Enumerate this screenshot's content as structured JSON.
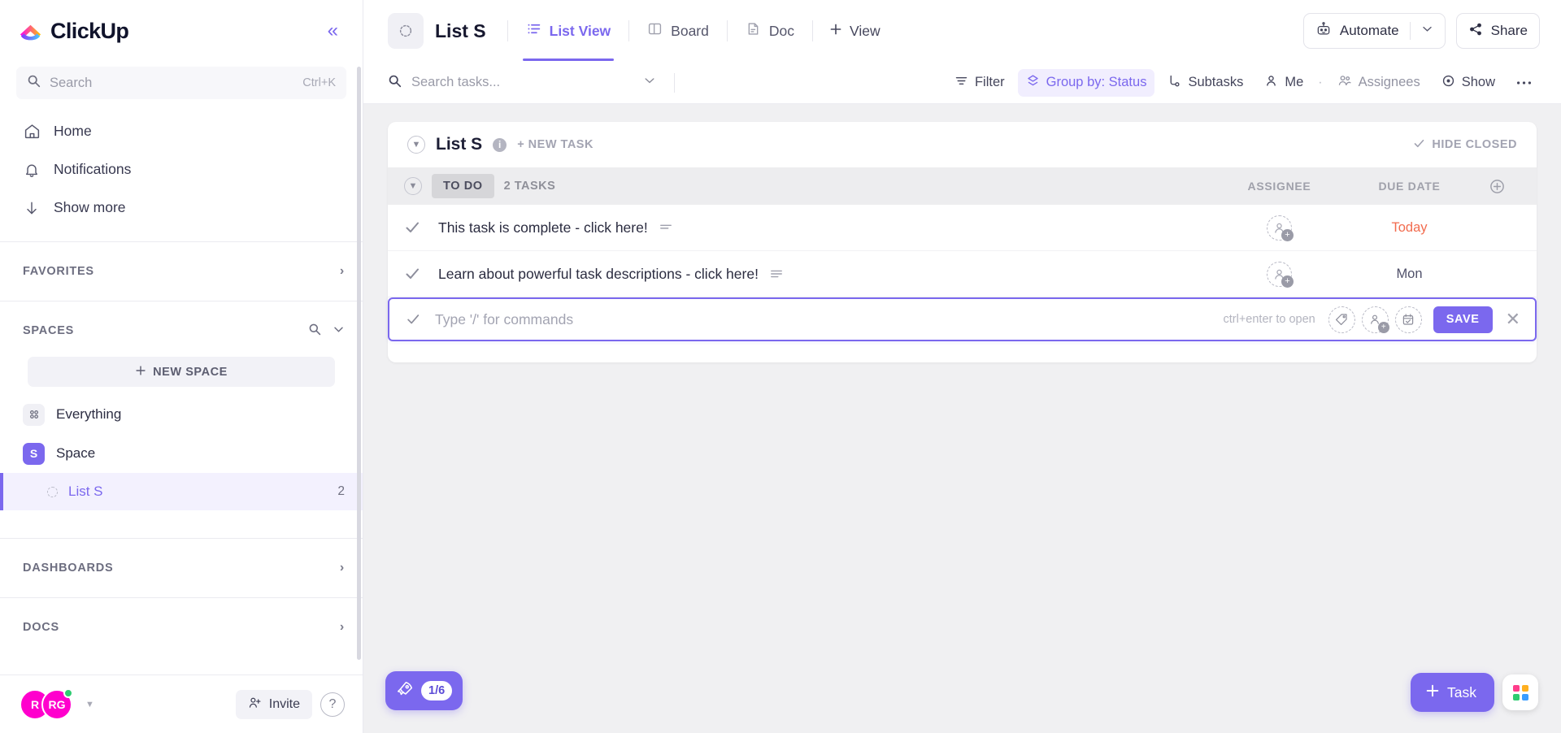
{
  "brand": {
    "name": "ClickUp",
    "accent": "#7b68ee",
    "logo_icon": "clickup-logo-icon"
  },
  "sidebar": {
    "search": {
      "placeholder": "Search",
      "shortcut": "Ctrl+K",
      "icon": "search-icon"
    },
    "nav": [
      {
        "label": "Home",
        "icon": "home-icon"
      },
      {
        "label": "Notifications",
        "icon": "bell-icon"
      },
      {
        "label": "Show more",
        "icon": "arrow-down-icon"
      }
    ],
    "favorites": {
      "label": "FAVORITES",
      "chevron": "chevron-right-icon"
    },
    "spaces": {
      "label": "SPACES",
      "search_icon": "search-icon",
      "chevron_icon": "chevron-down-icon",
      "new_space_label": "NEW SPACE",
      "everything": {
        "label": "Everything",
        "icon": "grid-dots-icon"
      },
      "space": {
        "label": "Space",
        "initial": "S",
        "color": "#7b68ee"
      },
      "list": {
        "label": "List S",
        "count": "2"
      }
    },
    "dashboards": {
      "label": "DASHBOARDS",
      "chevron": "chevron-right-icon"
    },
    "docs": {
      "label": "DOCS",
      "chevron": "chevron-right-icon"
    },
    "footer": {
      "avatar_1": "R",
      "avatar_2": "RG",
      "avatar_color": "#ff00cd",
      "status_color": "#2ecc71",
      "invite_label": "Invite",
      "invite_icon": "user-plus-icon",
      "help_label": "?"
    }
  },
  "topbar": {
    "collapse_icon": "collapse-sidebar-icon",
    "list_icon": "list-status-icon",
    "title": "List S",
    "tabs": [
      {
        "label": "List View",
        "icon": "list-view-icon",
        "active": true
      },
      {
        "label": "Board",
        "icon": "board-icon",
        "active": false
      },
      {
        "label": "Doc",
        "icon": "doc-icon",
        "active": false
      }
    ],
    "add_view_label": "View",
    "automate_label": "Automate",
    "automate_icon": "robot-icon",
    "share_label": "Share",
    "share_icon": "share-icon"
  },
  "toolbar": {
    "search_placeholder": "Search tasks...",
    "search_icon": "search-icon",
    "chevron_icon": "chevron-down-icon",
    "buttons": [
      {
        "label": "Filter",
        "icon": "filter-icon",
        "state": "normal"
      },
      {
        "label": "Group by: Status",
        "icon": "group-by-icon",
        "state": "accent"
      },
      {
        "label": "Subtasks",
        "icon": "subtasks-icon",
        "state": "normal"
      },
      {
        "label": "Me",
        "icon": "person-icon",
        "state": "normal"
      },
      {
        "label": "Assignees",
        "icon": "people-icon",
        "state": "muted"
      },
      {
        "label": "Show",
        "icon": "eye-icon",
        "state": "normal"
      }
    ],
    "more_icon": "more-horizontal-icon"
  },
  "list_panel": {
    "header": {
      "collapse_icon": "chevron-down-circle-icon",
      "title": "List S",
      "info_icon": "info-icon",
      "new_task_label": "+ NEW TASK",
      "hide_closed_label": "HIDE CLOSED",
      "hide_closed_icon": "check-icon"
    },
    "group": {
      "collapse_icon": "chevron-down-circle-icon",
      "status": "TO DO",
      "count_label": "2 TASKS",
      "columns": [
        {
          "label": "ASSIGNEE"
        },
        {
          "label": "DUE DATE"
        }
      ],
      "add_column_icon": "plus-circle-icon"
    },
    "tasks": [
      {
        "name": "This task is complete - click here!",
        "check_icon": "check-icon",
        "description_icon": "description-lines-icon",
        "assignee_icon": "add-assignee-icon",
        "due_date": "Today",
        "due_highlight": true
      },
      {
        "name": "Learn about powerful task descriptions - click here!",
        "check_icon": "check-icon",
        "description_icon": "description-lines-icon",
        "assignee_icon": "add-assignee-icon",
        "due_date": "Mon",
        "due_highlight": false
      }
    ],
    "new_task": {
      "check_icon": "check-icon",
      "placeholder": "Type '/' for commands",
      "hint": "ctrl+enter to open",
      "tag_icon": "tag-icon",
      "assignee_icon": "add-assignee-icon",
      "date_icon": "calendar-icon",
      "save_label": "SAVE",
      "close_icon": "close-icon"
    }
  },
  "floating": {
    "progress": {
      "icon": "rocket-icon",
      "value": "1/6"
    },
    "new_task": {
      "label": "Task",
      "icon": "plus-icon"
    },
    "apps": {
      "icon": "apps-grid-icon",
      "colors": [
        "#ff3d8b",
        "#ffb020",
        "#2ecc71",
        "#3b9dff"
      ]
    }
  }
}
